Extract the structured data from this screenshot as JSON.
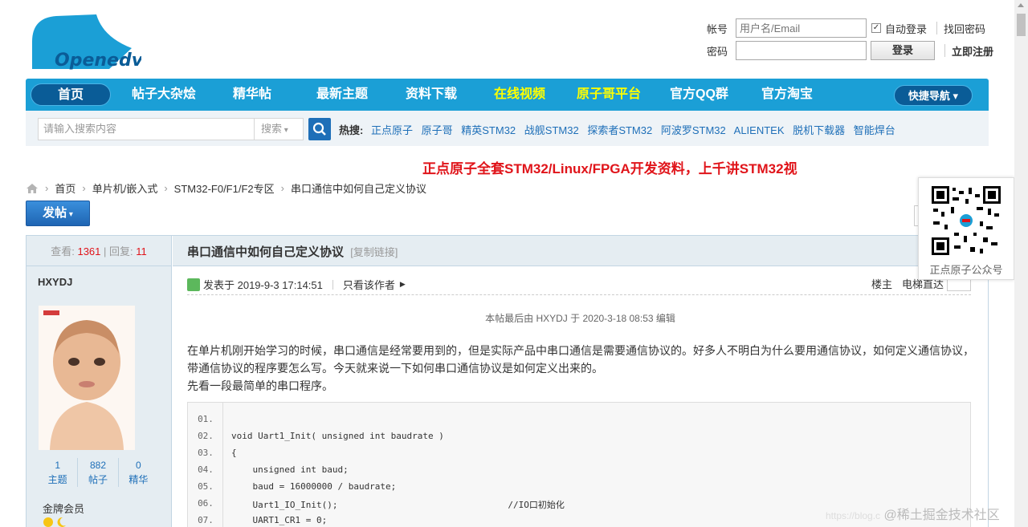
{
  "logo": {
    "text": "Openedv"
  },
  "login": {
    "account_label": "帐号",
    "account_placeholder": "用户名/Email",
    "auto_login": "自动登录",
    "find_password": "找回密码",
    "password_label": "密码",
    "login_button": "登录",
    "register": "立即注册"
  },
  "nav": {
    "items": [
      "首页",
      "帖子大杂烩",
      "精华帖",
      "最新主题",
      "资料下载",
      "在线视频",
      "原子哥平台",
      "官方QQ群",
      "官方淘宝"
    ],
    "quick": "快捷导航",
    "highlight_color": "#ffff00"
  },
  "search": {
    "placeholder": "请输入搜索内容",
    "select": "搜索",
    "hot_label": "热搜:",
    "hot": [
      "正点原子",
      "原子哥",
      "精英STM32",
      "战舰STM32",
      "探索者STM32",
      "阿波罗STM32",
      "ALIENTEK",
      "脱机下载器",
      "智能焊台"
    ]
  },
  "banner": "正点原子全套STM32/Linux/FPGA开发资料，上千讲STM32视",
  "breadcrumb": [
    "首页",
    "单片机/嵌入式",
    "STM32-F0/F1/F2专区",
    "串口通信中如何自己定义协议"
  ],
  "post_button": "发帖",
  "stats": {
    "views_label": "查看:",
    "views": "1361",
    "replies_label": "回复:",
    "replies": "11"
  },
  "author": {
    "name": "HXYDJ",
    "counts": [
      {
        "num": "1",
        "label": "主题"
      },
      {
        "num": "882",
        "label": "帖子"
      },
      {
        "num": "0",
        "label": "精华"
      }
    ],
    "rank": "金牌会员"
  },
  "thread": {
    "title": "串口通信中如何自己定义协议",
    "copy_link": "[复制链接]",
    "posted": "发表于 2019-9-3 17:14:51",
    "only_author": "只看该作者",
    "floor": "楼主",
    "elevator": "电梯直达",
    "edited": "本帖最后由 HXYDJ 于 2020-3-18 08:53 编辑",
    "body1": "在单片机刚开始学习的时候，串口通信是经常要用到的，但是实际产品中串口通信是需要通信协议的。好多人不明白为什么要用通信协议，如何定义通信协议，带通信协议的程序要怎么写。今天就来说一下如何串口通信协议是如何定义出来的。",
    "body2": "先看一段最简单的串口程序。"
  },
  "code": {
    "lines": [
      {
        "n": "01.",
        "t": ""
      },
      {
        "n": "02.",
        "t": "void Uart1_Init( unsigned int baudrate )"
      },
      {
        "n": "03.",
        "t": "{"
      },
      {
        "n": "04.",
        "t": "    unsigned int baud;"
      },
      {
        "n": "05.",
        "t": "    baud = 16000000 / baudrate;"
      },
      {
        "n": "06.",
        "t": "    Uart1_IO_Init();                                //IO口初始化"
      },
      {
        "n": "07.",
        "t": "    UART1_CR1 = 0;"
      }
    ]
  },
  "qr": {
    "caption": "正点原子公众号"
  },
  "watermark": {
    "url": "https://blog.c",
    "text": "@稀土掘金技术社区"
  }
}
